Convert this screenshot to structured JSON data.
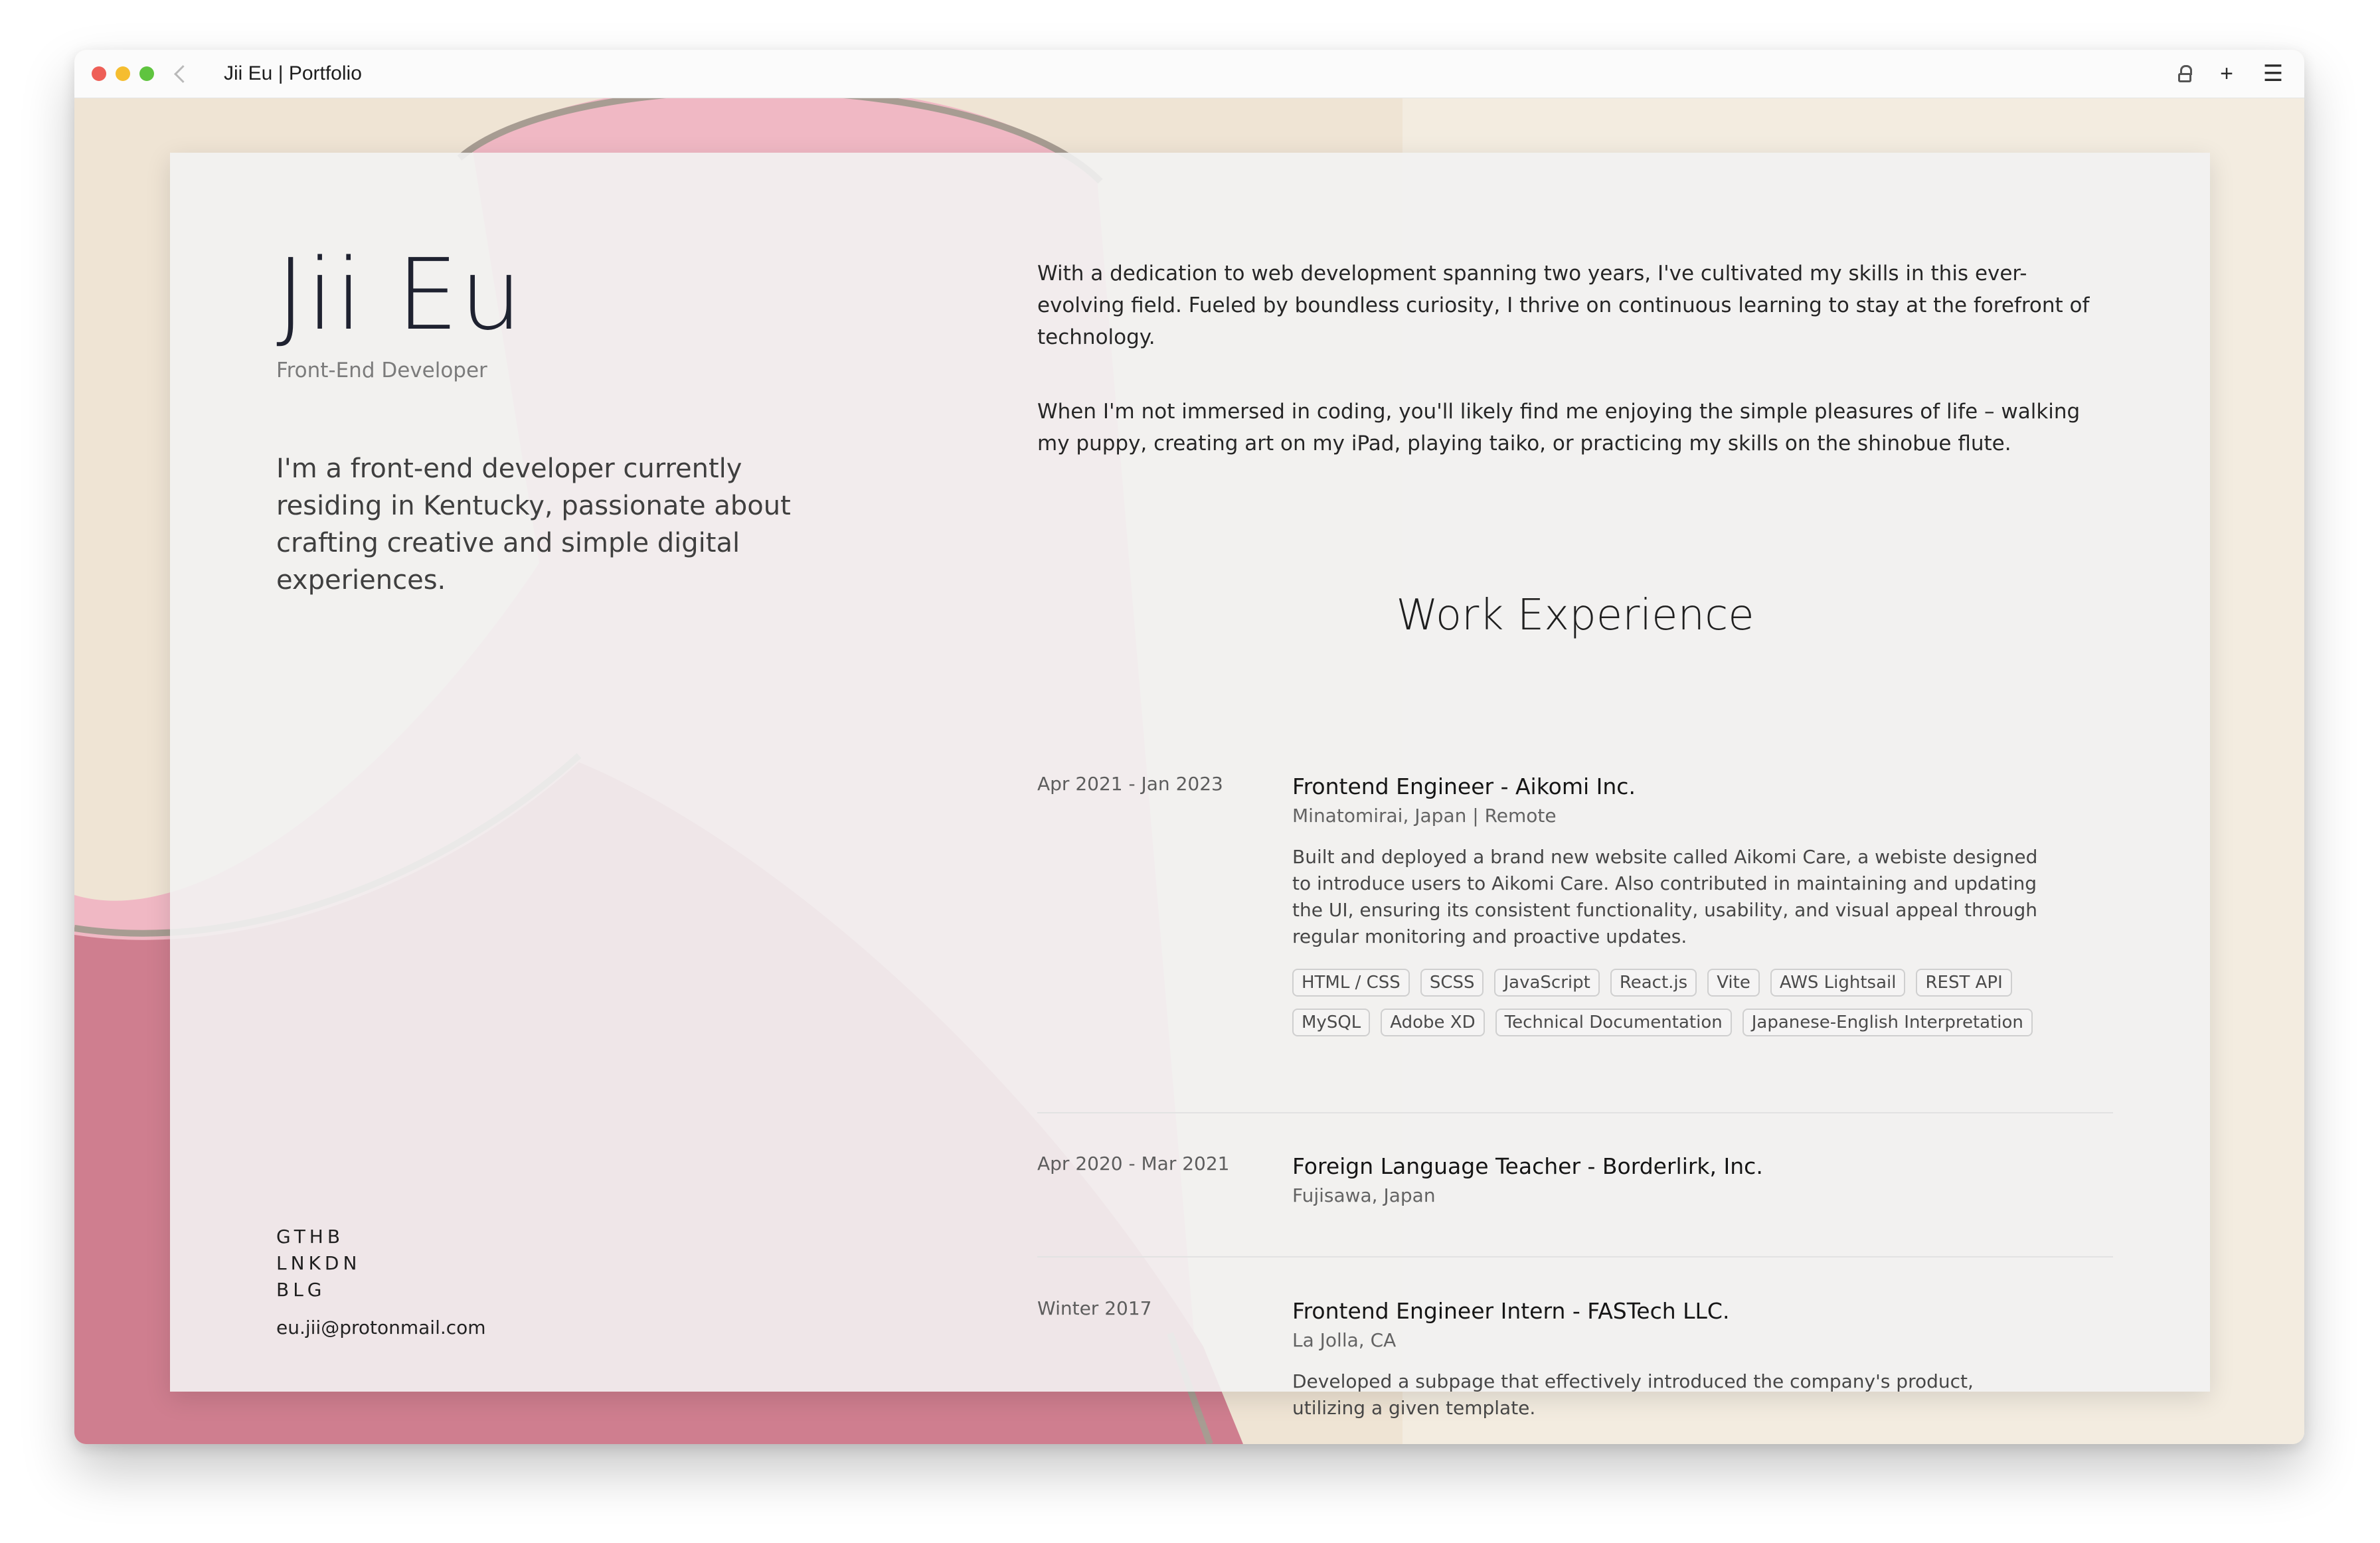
{
  "browser": {
    "tab_title": "Jii Eu | Portfolio",
    "icons": [
      "back-icon",
      "lock-icon",
      "plus-icon",
      "menu-icon"
    ]
  },
  "profile": {
    "name": "Jii Eu",
    "role": "Front-End Developer",
    "intro": "I'm a front-end developer currently residing in Kentucky, passionate about crafting creative and simple digital experiences."
  },
  "social": {
    "links": [
      "GTHB",
      "LNKDN",
      "BLG"
    ],
    "email": "eu.jii@protonmail.com"
  },
  "about": {
    "paragraphs": [
      "With a dedication to web development spanning two years, I've cultivated my skills in this ever-evolving field. Fueled by boundless curiosity, I thrive on continuous learning to stay at the forefront of technology.",
      "When I'm not immersed in coding, you'll likely find me enjoying the simple pleasures of life – walking my puppy, creating art on my iPad, playing taiko, or practicing my skills on the shinobue flute."
    ]
  },
  "work": {
    "title": "Work Experience",
    "jobs": [
      {
        "date": "Apr 2021 - Jan 2023",
        "title": "Frontend Engineer - Aikomi Inc.",
        "location": "Minatomirai, Japan | Remote",
        "description": "Built and deployed a brand new website called Aikomi Care, a webiste designed to introduce users to Aikomi Care. Also contributed in maintaining and updating the UI, ensuring its consistent functionality, usability, and visual appeal through regular monitoring and proactive updates.",
        "tags": [
          "HTML / CSS",
          "SCSS",
          "JavaScript",
          "React.js",
          "Vite",
          "AWS Lightsail",
          "REST API",
          "MySQL",
          "Adobe XD",
          "Technical Documentation",
          "Japanese-English Interpretation"
        ]
      },
      {
        "date": "Apr 2020 - Mar 2021",
        "title": "Foreign Language Teacher - Borderlirk, Inc.",
        "location": "Fujisawa, Japan"
      },
      {
        "date": "Winter 2017",
        "title": "Frontend Engineer Intern - FASTech LLC.",
        "location": "La Jolla, CA",
        "description": "Developed a subpage that effectively introduced the company's product, utilizing a given template."
      }
    ]
  },
  "colors": {
    "background": "#f3ece0",
    "art_pink": "#f0b8c4",
    "art_rose": "#cf7e8f",
    "card": "#f2f2f2",
    "text": "#1f2230"
  }
}
